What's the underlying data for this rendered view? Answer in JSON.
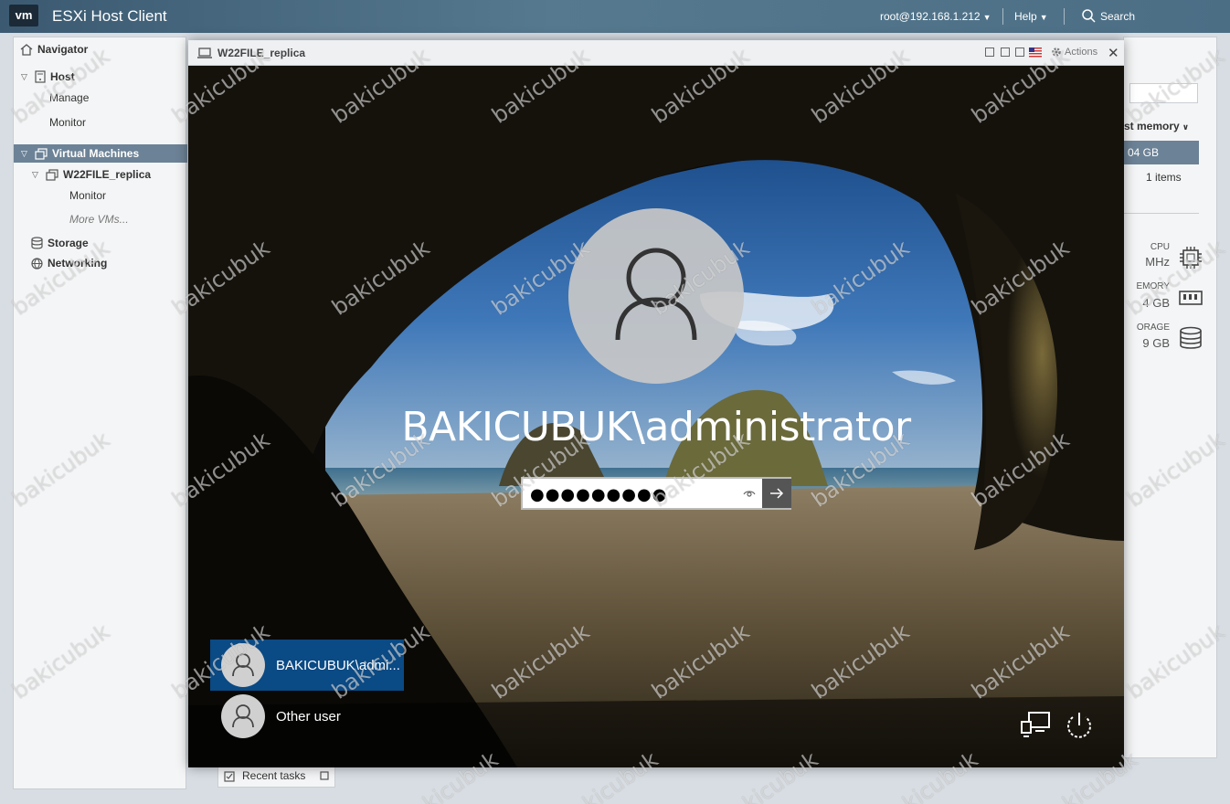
{
  "header": {
    "logo": "vm",
    "title": "ESXi Host Client",
    "user": "root@192.168.1.212",
    "help": "Help",
    "search": "Search"
  },
  "navigator": {
    "title": "Navigator",
    "host": "Host",
    "manage": "Manage",
    "monitor": "Monitor",
    "virtual_machines": "Virtual Machines",
    "vm_name": "W22FILE_replica",
    "vm_monitor": "Monitor",
    "more_vms": "More VMs...",
    "storage": "Storage",
    "networking": "Networking"
  },
  "right_panel": {
    "col_header": "st memory",
    "selected_row_value": "04 GB",
    "items_count": "1 items",
    "cpu_label": "CPU",
    "cpu_value": "MHz",
    "memory_label": "EMORY",
    "memory_value": "4 GB",
    "storage_label": "ORAGE",
    "storage_value": "9 GB"
  },
  "recent_tasks": {
    "label": "Recent tasks"
  },
  "console": {
    "title": "W22FILE_replica",
    "actions": "Actions"
  },
  "login": {
    "username": "BAKICUBUK\\administrator",
    "password_value": "●●●●●●●●●"
  },
  "user_tiles": [
    {
      "label": "BAKICUBUK\\admi..."
    },
    {
      "label": "Other user"
    }
  ],
  "watermark": "bakicubuk",
  "colors": {
    "header_bg": "#4c6e85",
    "selected_nav": "#6c8296",
    "selected_tile": "#0a4a85"
  }
}
